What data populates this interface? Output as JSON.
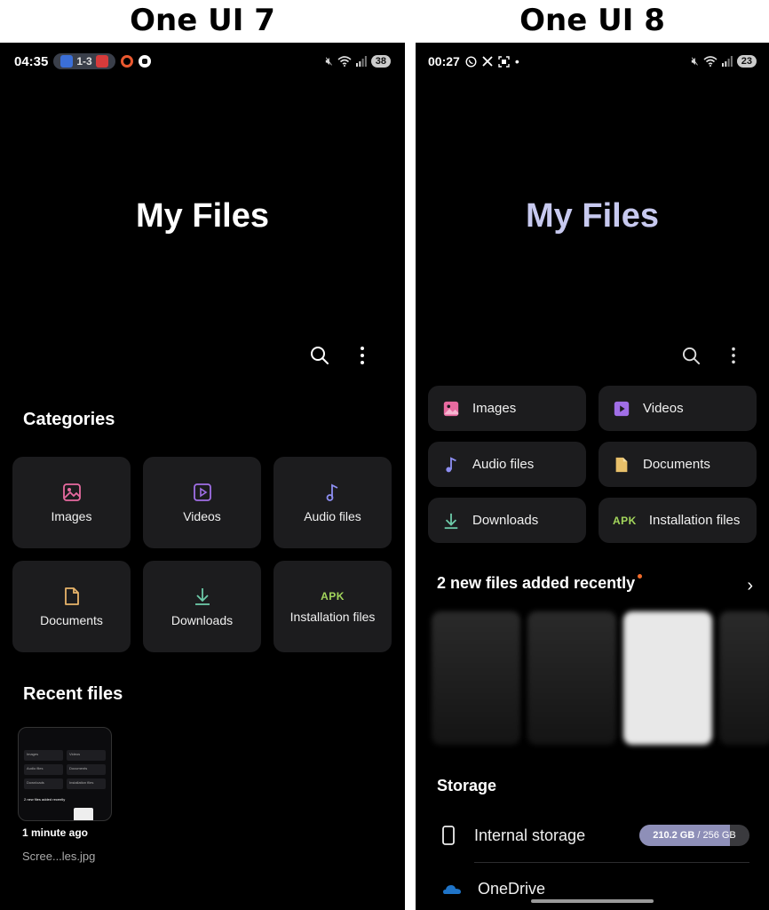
{
  "labels": {
    "left": "One UI 7",
    "right": "One UI 8"
  },
  "left": {
    "status": {
      "time": "04:35",
      "score": "1-3",
      "battery": "38"
    },
    "title": "My Files",
    "categories_title": "Categories",
    "categories": [
      {
        "label": "Images",
        "icon": "image-icon",
        "color": "#e86aa0"
      },
      {
        "label": "Videos",
        "icon": "video-icon",
        "color": "#a06ee6"
      },
      {
        "label": "Audio files",
        "icon": "music-icon",
        "color": "#8d8ef2"
      },
      {
        "label": "Documents",
        "icon": "document-icon",
        "color": "#e8b46a"
      },
      {
        "label": "Downloads",
        "icon": "download-icon",
        "color": "#6cc9a8"
      },
      {
        "label": "Installation files",
        "icon": "apk-icon",
        "apk": "APK",
        "color": "#a3d65c"
      }
    ],
    "recent_title": "Recent files",
    "recent": {
      "time": "1 minute ago",
      "name": "Scree...les.jpg"
    },
    "thumb": {
      "cells": [
        "Images",
        "Videos",
        "Audio files",
        "Documents",
        "Downloads",
        "Installation files"
      ],
      "recent_text": "2 new files added recently"
    }
  },
  "right": {
    "status": {
      "time": "00:27",
      "battery": "23"
    },
    "title": "My Files",
    "chips": [
      {
        "label": "Images",
        "icon": "image-icon",
        "color": "#e86aa0"
      },
      {
        "label": "Videos",
        "icon": "video-icon",
        "color": "#a06ee6"
      },
      {
        "label": "Audio files",
        "icon": "music-icon",
        "color": "#8d8ef2"
      },
      {
        "label": "Documents",
        "icon": "document-icon",
        "color": "#e8c06a"
      },
      {
        "label": "Downloads",
        "icon": "download-icon",
        "color": "#6cc9a8"
      },
      {
        "label": "Installation files",
        "icon": "apk-icon",
        "apk": "APK",
        "color": "#a3d65c"
      }
    ],
    "recent_header": "2 new files added recently",
    "storage_title": "Storage",
    "storage": [
      {
        "label": "Internal storage",
        "used": "210.2 GB",
        "total": "256 GB",
        "used_fraction": 0.82
      },
      {
        "label": "OneDrive"
      }
    ]
  }
}
